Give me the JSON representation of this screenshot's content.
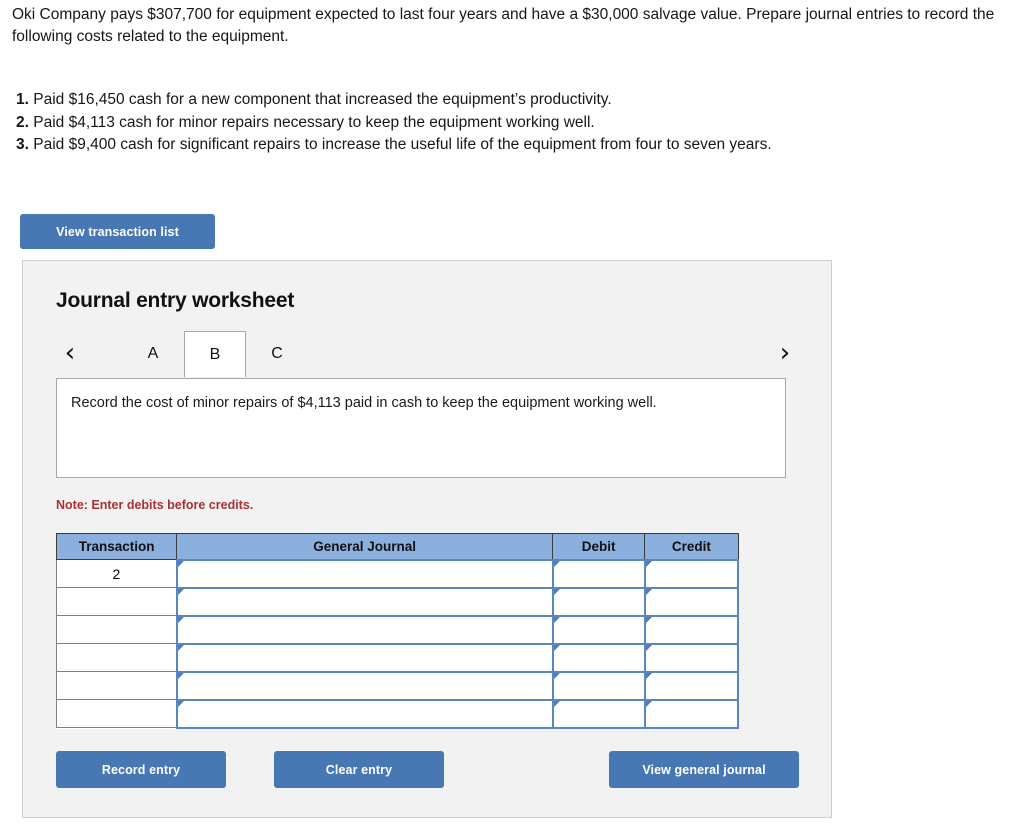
{
  "problem": {
    "paragraph": "Oki Company pays $307,700 for equipment expected to last four years and have a $30,000 salvage value. Prepare journal entries to record the following costs related to the equipment.",
    "items": [
      {
        "number": "1.",
        "text": "Paid $16,450 cash for a new component that increased the equipment’s productivity."
      },
      {
        "number": "2.",
        "text": "Paid $4,113 cash for minor repairs necessary to keep the equipment working well."
      },
      {
        "number": "3.",
        "text": "Paid $9,400 cash for significant repairs to increase the useful life of the equipment from four to seven years."
      }
    ]
  },
  "toolbar": {
    "view_transaction_list_label": "View transaction list"
  },
  "worksheet": {
    "title": "Journal entry worksheet",
    "prev_arrow": "‹",
    "next_arrow": "›",
    "tabs": [
      {
        "label": "A",
        "active": false
      },
      {
        "label": "B",
        "active": true
      },
      {
        "label": "C",
        "active": false
      }
    ],
    "instruction": "Record the cost of minor repairs of $4,113 paid in cash to keep the equipment working well.",
    "note": "Note: Enter debits before credits.",
    "table": {
      "headers": [
        "Transaction",
        "General Journal",
        "Debit",
        "Credit"
      ],
      "rows": [
        {
          "transaction": "2",
          "general_journal": "",
          "debit": "",
          "credit": ""
        },
        {
          "transaction": "",
          "general_journal": "",
          "debit": "",
          "credit": ""
        },
        {
          "transaction": "",
          "general_journal": "",
          "debit": "",
          "credit": ""
        },
        {
          "transaction": "",
          "general_journal": "",
          "debit": "",
          "credit": ""
        },
        {
          "transaction": "",
          "general_journal": "",
          "debit": "",
          "credit": ""
        },
        {
          "transaction": "",
          "general_journal": "",
          "debit": "",
          "credit": ""
        }
      ]
    },
    "buttons": {
      "record_entry": "Record entry",
      "clear_entry": "Clear entry",
      "view_general_journal": "View general journal"
    }
  },
  "colors": {
    "button_blue": "#4878b4",
    "table_header_blue": "#8cb0de",
    "cell_border_blue": "#5b87bf",
    "note_red": "#a83232",
    "panel_gray": "#f2f2f2"
  }
}
